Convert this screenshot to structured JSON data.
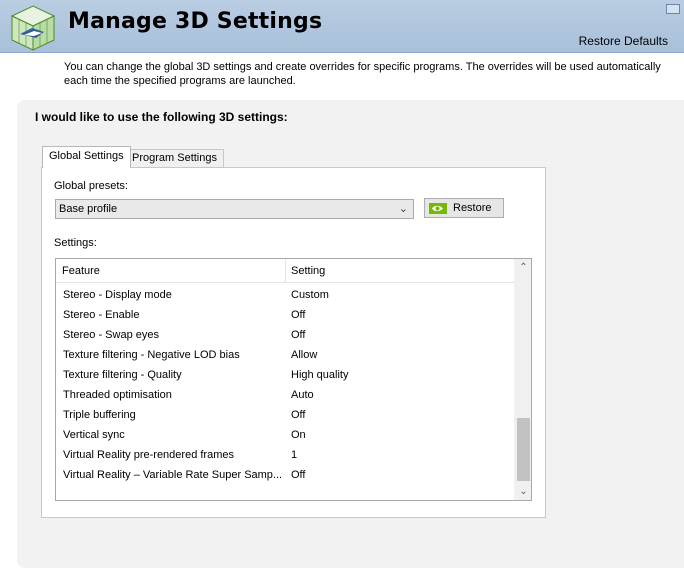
{
  "header": {
    "title": "Manage 3D Settings",
    "restore_defaults": "Restore Defaults",
    "logo_icon": "nvidia-3d-settings-logo-icon"
  },
  "description": "You can change the global 3D settings and create overrides for specific programs. The overrides will be used automatically each time the specified programs are launched.",
  "panel": {
    "heading": "I would like to use the following 3D settings:",
    "tabs": [
      {
        "label": "Global Settings",
        "active": true
      },
      {
        "label": "Program Settings",
        "active": false
      }
    ],
    "presets_label": "Global presets:",
    "preset_value": "Base profile",
    "restore_button": "Restore",
    "settings_label": "Settings:",
    "table": {
      "headers": [
        "Feature",
        "Setting"
      ],
      "rows": [
        {
          "feature": "Stereo - Display mode",
          "setting": "Custom"
        },
        {
          "feature": "Stereo - Enable",
          "setting": "Off"
        },
        {
          "feature": "Stereo - Swap eyes",
          "setting": "Off"
        },
        {
          "feature": "Texture filtering - Negative LOD bias",
          "setting": "Allow"
        },
        {
          "feature": "Texture filtering - Quality",
          "setting": "High quality"
        },
        {
          "feature": "Threaded optimisation",
          "setting": "Auto"
        },
        {
          "feature": "Triple buffering",
          "setting": "Off"
        },
        {
          "feature": "Vertical sync",
          "setting": "On"
        },
        {
          "feature": "Virtual Reality pre-rendered frames",
          "setting": "1"
        },
        {
          "feature": "Virtual Reality – Variable Rate Super Samp...",
          "setting": "Off"
        }
      ]
    }
  },
  "colors": {
    "header_bg": "#b9cde2",
    "panel_bg": "#f2f2f2",
    "nvidia_green": "#76b900"
  }
}
